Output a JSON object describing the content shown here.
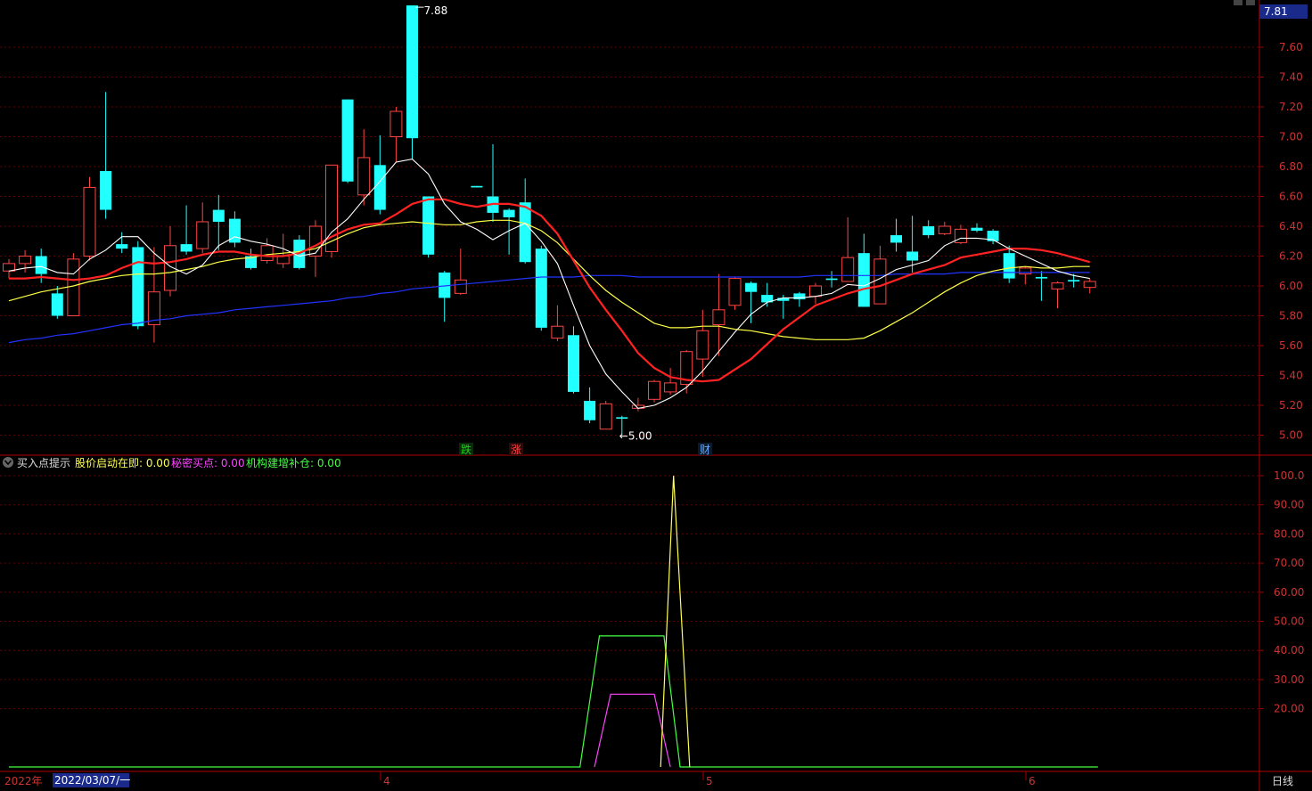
{
  "top_right_price": "7.81",
  "price_axis": {
    "ticks": [
      "7.60",
      "7.40",
      "7.20",
      "7.00",
      "6.80",
      "6.60",
      "6.40",
      "6.20",
      "6.00",
      "5.80",
      "5.60",
      "5.40",
      "5.20",
      "5.00"
    ],
    "ylim": [
      4.9,
      7.9
    ]
  },
  "indicator_axis": {
    "ticks": [
      "100.0",
      "90.00",
      "80.00",
      "70.00",
      "60.00",
      "50.00",
      "40.00",
      "30.00",
      "20.00"
    ],
    "ylim": [
      0,
      100
    ]
  },
  "indicator_legend": {
    "name": "买入点提示",
    "items": [
      {
        "label": "股价启动在即: 0.00",
        "color": "#ffff55"
      },
      {
        "label": "秘密买点: 0.00",
        "color": "#ff44ff"
      },
      {
        "label": "机构建增补仓: 0.00",
        "color": "#44ff44"
      }
    ]
  },
  "annotations": {
    "high_label": "7.88",
    "low_label": "←5.00"
  },
  "markers": [
    {
      "text": "跌",
      "color": "#22cc22",
      "bg": "#0a2a0a"
    },
    {
      "text": "涨",
      "color": "#ff4444",
      "bg": "#2a0a0a"
    },
    {
      "text": "财",
      "color": "#66aaff",
      "bg": "#0a1a2a"
    }
  ],
  "time_axis": {
    "year_label": "2022年",
    "cursor_label": "2022/03/07/一",
    "month_labels": [
      "4",
      "5",
      "6"
    ],
    "period_label": "日线"
  },
  "colors": {
    "up": "#ff4444",
    "down": "#22ffff",
    "grid": "#660000",
    "axis": "#990000",
    "ma5": "#ffffff",
    "ma10": "#ff2222",
    "ma20": "#ffff44",
    "ma60": "#2233ff"
  },
  "chart_data": {
    "type": "candlestick",
    "candles": [
      [
        6.1,
        6.15,
        6.05,
        6.18
      ],
      [
        6.15,
        6.2,
        6.09,
        6.24
      ],
      [
        6.2,
        6.08,
        6.02,
        6.25
      ],
      [
        5.95,
        5.8,
        5.78,
        6.0
      ],
      [
        5.8,
        6.18,
        5.8,
        6.22
      ],
      [
        6.2,
        6.66,
        6.17,
        6.73
      ],
      [
        6.77,
        6.51,
        6.45,
        7.3
      ],
      [
        6.28,
        6.25,
        6.22,
        6.36
      ],
      [
        6.26,
        5.73,
        5.71,
        6.3
      ],
      [
        5.74,
        5.96,
        5.62,
        6.26
      ],
      [
        5.97,
        6.27,
        5.93,
        6.4
      ],
      [
        6.28,
        6.23,
        6.21,
        6.54
      ],
      [
        6.25,
        6.43,
        6.22,
        6.56
      ],
      [
        6.51,
        6.43,
        6.24,
        6.61
      ],
      [
        6.45,
        6.29,
        6.26,
        6.5
      ],
      [
        6.2,
        6.12,
        6.11,
        6.25
      ],
      [
        6.17,
        6.27,
        6.15,
        6.32
      ],
      [
        6.15,
        6.2,
        6.12,
        6.35
      ],
      [
        6.31,
        6.12,
        6.11,
        6.34
      ],
      [
        6.2,
        6.4,
        6.06,
        6.44
      ],
      [
        6.23,
        6.81,
        6.19,
        6.81
      ],
      [
        7.25,
        6.7,
        6.69,
        7.25
      ],
      [
        6.61,
        6.86,
        6.54,
        7.05
      ],
      [
        6.81,
        6.51,
        6.48,
        7.01
      ],
      [
        7.0,
        7.17,
        6.83,
        7.2
      ],
      [
        7.88,
        6.99,
        6.85,
        7.88
      ],
      [
        6.6,
        6.21,
        6.19,
        6.6
      ],
      [
        6.09,
        5.92,
        5.76,
        6.1
      ],
      [
        5.95,
        6.04,
        5.94,
        6.25
      ],
      [
        6.67,
        6.66,
        6.66,
        6.67
      ],
      [
        6.6,
        6.49,
        6.43,
        6.95
      ],
      [
        6.51,
        6.46,
        6.21,
        6.52
      ],
      [
        6.56,
        6.16,
        6.15,
        6.72
      ],
      [
        6.25,
        5.72,
        5.7,
        6.27
      ],
      [
        5.65,
        5.73,
        5.63,
        5.87
      ],
      [
        5.67,
        5.29,
        5.28,
        5.73
      ],
      [
        5.23,
        5.1,
        5.08,
        5.32
      ],
      [
        5.04,
        5.21,
        5.04,
        5.23
      ],
      [
        5.12,
        5.11,
        5.0,
        5.13
      ],
      [
        5.18,
        5.2,
        5.16,
        5.25
      ],
      [
        5.24,
        5.36,
        5.22,
        5.37
      ],
      [
        5.29,
        5.35,
        5.27,
        5.45
      ],
      [
        5.34,
        5.56,
        5.28,
        5.57
      ],
      [
        5.51,
        5.7,
        5.39,
        5.84
      ],
      [
        5.74,
        5.84,
        5.53,
        6.08
      ],
      [
        5.87,
        6.05,
        5.84,
        6.06
      ],
      [
        6.02,
        5.96,
        5.75,
        6.03
      ],
      [
        5.94,
        5.89,
        5.86,
        6.02
      ],
      [
        5.92,
        5.9,
        5.78,
        5.94
      ],
      [
        5.95,
        5.91,
        5.86,
        5.96
      ],
      [
        5.93,
        6.0,
        5.88,
        6.02
      ],
      [
        6.05,
        6.04,
        5.99,
        6.1
      ],
      [
        6.03,
        6.19,
        6.03,
        6.46
      ],
      [
        6.22,
        5.86,
        5.86,
        6.35
      ],
      [
        5.88,
        6.18,
        5.88,
        6.27
      ],
      [
        6.34,
        6.29,
        6.23,
        6.45
      ],
      [
        6.23,
        6.17,
        6.09,
        6.47
      ],
      [
        6.4,
        6.34,
        6.32,
        6.44
      ],
      [
        6.35,
        6.4,
        6.34,
        6.43
      ],
      [
        6.29,
        6.38,
        6.28,
        6.41
      ],
      [
        6.39,
        6.37,
        6.36,
        6.42
      ],
      [
        6.37,
        6.3,
        6.28,
        6.38
      ],
      [
        6.22,
        6.05,
        6.02,
        6.27
      ],
      [
        6.08,
        6.12,
        6.01,
        6.13
      ],
      [
        6.06,
        6.05,
        5.9,
        6.1
      ],
      [
        5.98,
        6.02,
        5.85,
        6.03
      ],
      [
        6.04,
        6.03,
        5.99,
        6.08
      ],
      [
        5.99,
        6.03,
        5.95,
        6.05
      ]
    ],
    "annotation_high": 7.88,
    "annotation_low": 5.0,
    "ma_series": [
      {
        "key": "ma5",
        "values": [
          6.1,
          6.12,
          6.13,
          6.09,
          6.08,
          6.18,
          6.24,
          6.33,
          6.33,
          6.22,
          6.13,
          6.08,
          6.14,
          6.27,
          6.33,
          6.3,
          6.28,
          6.25,
          6.2,
          6.22,
          6.36,
          6.45,
          6.58,
          6.7,
          6.83,
          6.85,
          6.75,
          6.55,
          6.43,
          6.38,
          6.31,
          6.37,
          6.42,
          6.3,
          6.15,
          5.87,
          5.6,
          5.41,
          5.29,
          5.18,
          5.2,
          5.25,
          5.32,
          5.43,
          5.56,
          5.69,
          5.81,
          5.89,
          5.92,
          5.92,
          5.93,
          5.95,
          6.01,
          6.0,
          6.05,
          6.11,
          6.14,
          6.17,
          6.27,
          6.32,
          6.32,
          6.31,
          6.25,
          6.2,
          6.15,
          6.1,
          6.07,
          6.05
        ]
      },
      {
        "key": "ma10",
        "values": [
          6.05,
          6.05,
          6.06,
          6.05,
          6.04,
          6.05,
          6.07,
          6.12,
          6.16,
          6.15,
          6.16,
          6.18,
          6.21,
          6.23,
          6.23,
          6.21,
          6.2,
          6.2,
          6.22,
          6.27,
          6.33,
          6.38,
          6.41,
          6.42,
          6.48,
          6.55,
          6.58,
          6.58,
          6.55,
          6.53,
          6.55,
          6.55,
          6.53,
          6.47,
          6.35,
          6.17,
          5.99,
          5.84,
          5.7,
          5.55,
          5.45,
          5.39,
          5.37,
          5.36,
          5.37,
          5.44,
          5.51,
          5.61,
          5.71,
          5.79,
          5.87,
          5.91,
          5.95,
          5.98,
          6.0,
          6.04,
          6.08,
          6.11,
          6.14,
          6.19,
          6.21,
          6.23,
          6.25,
          6.25,
          6.24,
          6.22,
          6.19,
          6.16
        ]
      },
      {
        "key": "ma20",
        "values": [
          5.9,
          5.93,
          5.96,
          5.98,
          6.0,
          6.03,
          6.05,
          6.07,
          6.08,
          6.08,
          6.09,
          6.11,
          6.13,
          6.16,
          6.18,
          6.19,
          6.21,
          6.22,
          6.23,
          6.25,
          6.3,
          6.35,
          6.39,
          6.41,
          6.42,
          6.43,
          6.42,
          6.41,
          6.41,
          6.43,
          6.44,
          6.44,
          6.42,
          6.37,
          6.29,
          6.18,
          6.07,
          5.97,
          5.89,
          5.82,
          5.75,
          5.72,
          5.72,
          5.73,
          5.73,
          5.71,
          5.7,
          5.68,
          5.66,
          5.65,
          5.64,
          5.64,
          5.64,
          5.65,
          5.7,
          5.76,
          5.82,
          5.89,
          5.96,
          6.02,
          6.07,
          6.1,
          6.12,
          6.13,
          6.12,
          6.12,
          6.13,
          6.13
        ]
      },
      {
        "key": "ma60",
        "values": [
          5.62,
          5.64,
          5.65,
          5.67,
          5.68,
          5.7,
          5.72,
          5.74,
          5.75,
          5.77,
          5.78,
          5.8,
          5.81,
          5.82,
          5.84,
          5.85,
          5.86,
          5.87,
          5.88,
          5.89,
          5.9,
          5.92,
          5.93,
          5.95,
          5.96,
          5.98,
          5.99,
          6.0,
          6.01,
          6.02,
          6.03,
          6.04,
          6.05,
          6.06,
          6.06,
          6.06,
          6.07,
          6.07,
          6.07,
          6.06,
          6.06,
          6.06,
          6.06,
          6.06,
          6.06,
          6.06,
          6.06,
          6.06,
          6.06,
          6.06,
          6.07,
          6.07,
          6.07,
          6.07,
          6.07,
          6.08,
          6.08,
          6.08,
          6.08,
          6.09,
          6.09,
          6.09,
          6.09,
          6.09,
          6.09,
          6.09,
          6.09,
          6.09
        ]
      }
    ],
    "indicator_series": [
      {
        "key": "green",
        "color": "#44ff44",
        "points": [
          [
            0,
            0
          ],
          [
            35.4,
            0
          ],
          [
            36.6,
            45
          ],
          [
            40.6,
            45
          ],
          [
            41.6,
            0
          ],
          [
            67.5,
            0
          ]
        ]
      },
      {
        "key": "magenta",
        "color": "#ff44ff",
        "points": [
          [
            36.3,
            0
          ],
          [
            37.3,
            25
          ],
          [
            40.0,
            25
          ],
          [
            41.0,
            0
          ]
        ]
      },
      {
        "key": "yellow",
        "color": "#ffff55",
        "points": [
          [
            40.4,
            0
          ],
          [
            41.2,
            100
          ],
          [
            42.2,
            0
          ]
        ]
      }
    ]
  }
}
